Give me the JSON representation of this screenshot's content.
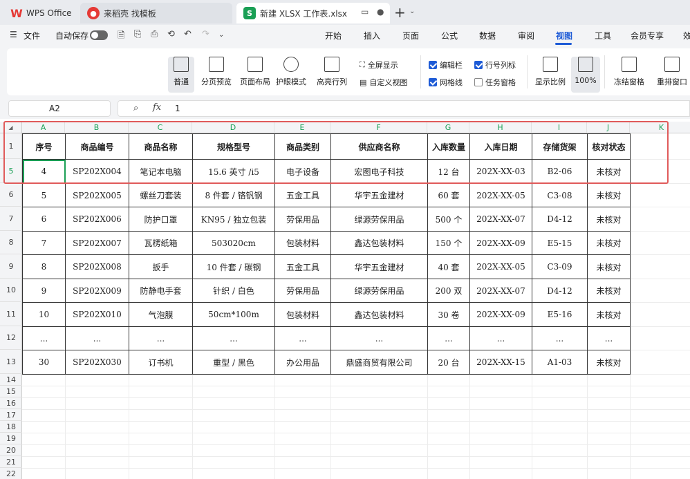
{
  "tabs": {
    "wps": "WPS Office",
    "template": "来稻壳 找模板",
    "file": "新建 XLSX 工作表.xlsx"
  },
  "menu": {
    "file": "文件",
    "autosave": "自动保存",
    "items": [
      "开始",
      "插入",
      "页面",
      "公式",
      "数据",
      "审阅",
      "视图",
      "工具",
      "会员专享",
      "效"
    ],
    "active": "视图"
  },
  "ribbon": {
    "normal": "普通",
    "page_break": "分页预览",
    "page_layout": "页面布局",
    "eye_mode": "护眼模式",
    "highlight": "高亮行列",
    "fullscreen": "全屏显示",
    "custom_view": "自定义视图",
    "edit_bar": "编辑栏",
    "row_col_labels": "行号列标",
    "gridlines": "网格线",
    "task_pane": "任务窗格",
    "zoom_ratio": "显示比例",
    "zoom_100": "100%",
    "freeze": "冻结窗格",
    "rearrange": "重排窗口"
  },
  "formula": {
    "cell_ref": "A2",
    "fx": "fx",
    "value": "1"
  },
  "columns": [
    "A",
    "B",
    "C",
    "D",
    "E",
    "F",
    "G",
    "H",
    "I",
    "J",
    "K"
  ],
  "row_numbers": [
    "1",
    "5",
    "6",
    "7",
    "8",
    "9",
    "10",
    "11",
    "12",
    "13",
    "14",
    "15",
    "16",
    "17",
    "18",
    "19",
    "20",
    "21",
    "22"
  ],
  "table": {
    "headers": [
      "序号",
      "商品编号",
      "商品名称",
      "规格型号",
      "商品类别",
      "供应商名称",
      "入库数量",
      "入库日期",
      "存储货架",
      "核对状态"
    ],
    "rows": [
      [
        "4",
        "SP202X004",
        "笔记本电脑",
        "15.6 英寸 /i5",
        "电子设备",
        "宏图电子科技",
        "12 台",
        "202X-XX-03",
        "B2-06",
        "未核对"
      ],
      [
        "5",
        "SP202X005",
        "螺丝刀套装",
        "8 件套 / 铬钒钢",
        "五金工具",
        "华宇五金建材",
        "60 套",
        "202X-XX-05",
        "C3-08",
        "未核对"
      ],
      [
        "6",
        "SP202X006",
        "防护口罩",
        "KN95 / 独立包装",
        "劳保用品",
        "绿源劳保用品",
        "500 个",
        "202X-XX-07",
        "D4-12",
        "未核对"
      ],
      [
        "7",
        "SP202X007",
        "瓦楞纸箱",
        "503020cm",
        "包装材料",
        "鑫达包装材料",
        "150 个",
        "202X-XX-09",
        "E5-15",
        "未核对"
      ],
      [
        "8",
        "SP202X008",
        "扳手",
        "10 件套 / 碳钢",
        "五金工具",
        "华宇五金建材",
        "40 套",
        "202X-XX-05",
        "C3-09",
        "未核对"
      ],
      [
        "9",
        "SP202X009",
        "防静电手套",
        "针织 / 白色",
        "劳保用品",
        "绿源劳保用品",
        "200 双",
        "202X-XX-07",
        "D4-12",
        "未核对"
      ],
      [
        "10",
        "SP202X010",
        "气泡膜",
        "50cm*100m",
        "包装材料",
        "鑫达包装材料",
        "30 卷",
        "202X-XX-09",
        "E5-16",
        "未核对"
      ],
      [
        "...",
        "...",
        "...",
        "...",
        "...",
        "...",
        "...",
        "...",
        "...",
        "..."
      ],
      [
        "30",
        "SP202X030",
        "订书机",
        "重型 / 黑色",
        "办公用品",
        "鼎盛商贸有限公司",
        "20 台",
        "202X-XX-15",
        "A1-03",
        "未核对"
      ]
    ]
  },
  "colors": {
    "accent": "#1e5bd6",
    "sheet_green": "#1a9f55",
    "highlight_red": "#e05a5a"
  }
}
